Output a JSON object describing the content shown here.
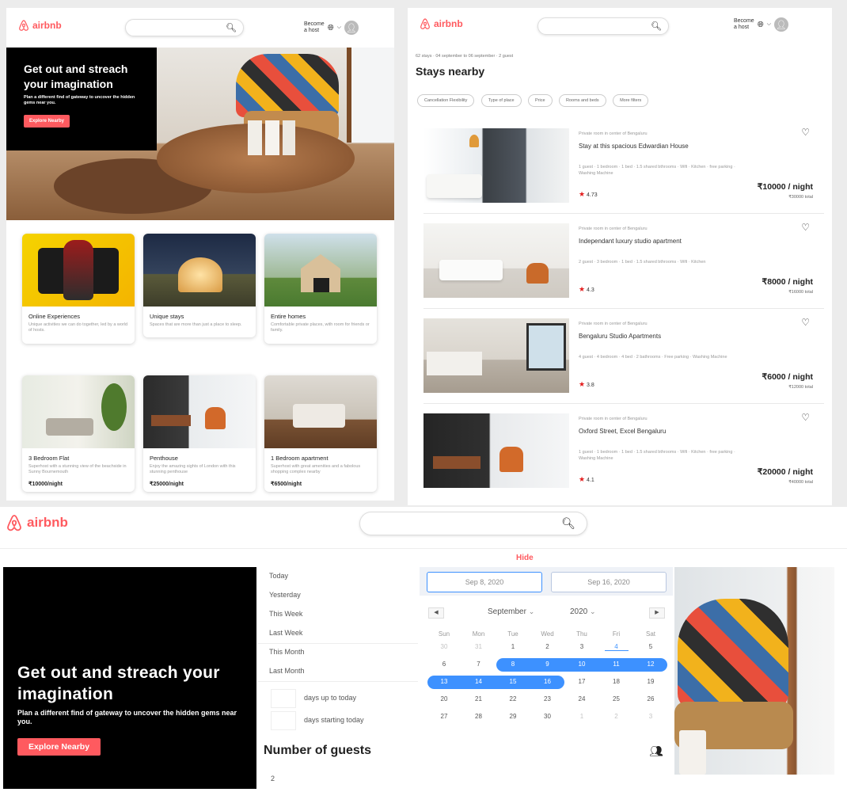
{
  "brand": "airbnb",
  "colors": {
    "accent": "#ff5a5f",
    "calendar_selection": "#3d91ff",
    "star": "#e31c1c"
  },
  "home": {
    "header": {
      "become_host": "Become\na host",
      "globe_icon": "globe",
      "chevron_icon": "chevron-down"
    },
    "hero": {
      "title": "Get out and streach your imagination",
      "subtitle": "Plan a different find of gateway to uncover the hidden gems near you.",
      "button": "Explore Nearby"
    },
    "categories": [
      {
        "title": "Online Experiences",
        "desc": "Unique activities we can do together, led by a world of hosts."
      },
      {
        "title": "Unique stays",
        "desc": "Spaces that are more than just a place to sleep."
      },
      {
        "title": "Entire homes",
        "desc": "Comfortable private places, with room for friends or family."
      }
    ],
    "stays": [
      {
        "title": "3 Bedroom Flat",
        "desc": "Superhost with a stunning view of the beachside in Sunny Bournemouth",
        "price": "₹10000/night"
      },
      {
        "title": "Penthouse",
        "desc": "Enjoy the amazing sights of London with this stunning penthouse",
        "price": "₹25000/night"
      },
      {
        "title": "1 Bedroom apartment",
        "desc": "Superhost with great amenities and a fabolous shopping complex nearby",
        "price": "₹6500/night"
      }
    ]
  },
  "results": {
    "meta": "62 stays · 04 september to 06 september · 2 guest",
    "title": "Stays nearby",
    "filters": [
      "Cancellation Flexibility",
      "Type of place",
      "Price",
      "Rooms and beds",
      "More filters"
    ],
    "listings": [
      {
        "location": "Private room in center of Bengaluru",
        "title": "Stay at this spacious Edwardian House",
        "features": "1 guest · 1 bedroom · 1 bed · 1.5 shared bthrooms · Wifi · Kitchen · free parking · Washing Machine",
        "rating": "4.73",
        "price": "₹10000 / night",
        "total": "₹30000 total"
      },
      {
        "location": "Private room in center of Bengaluru",
        "title": "Independant luxury studio apartment",
        "features": "2 guest · 3 bedroom · 1 bed · 1.5 shared bthrooms · Wifi · Kitchen",
        "rating": "4.3",
        "price": "₹8000 / night",
        "total": "₹16000 total"
      },
      {
        "location": "Private room in center of Bengaluru",
        "title": "Bengaluru Studio Apartments",
        "features": "4 guest · 4 bedroom · 4 bed · 2 bathrooms · Free parking · Washing Machine",
        "rating": "3.8",
        "price": "₹6000 / night",
        "total": "₹12000 total"
      },
      {
        "location": "Private room in center of Bengaluru",
        "title": "Oxford Street, Excel Bengaluru",
        "features": "1 guest · 1 bedroom · 1 bed · 1.5 shared bthrooms · Wifi · Kitchen · free parking · Washing Machine",
        "rating": "4.1",
        "price": "₹20000 / night",
        "total": "₹40000 total"
      }
    ]
  },
  "search_view": {
    "hide": "Hide",
    "hero": {
      "title": "Get out and streach your imagination",
      "subtitle": "Plan a different find of gateway to uncover the hidden gems near you.",
      "button": "Explore Nearby"
    },
    "ranges": [
      "Today",
      "Yesterday",
      "This Week",
      "Last Week",
      "This Month",
      "Last Month"
    ],
    "days_up": "days up to today",
    "days_starting": "days starting today",
    "start_date": "Sep 8, 2020",
    "end_date": "Sep 16, 2020",
    "month": "September",
    "year": "2020",
    "prev_icon": "arrow-left",
    "next_icon": "arrow-right",
    "weekdays": [
      "Sun",
      "Mon",
      "Tue",
      "Wed",
      "Thu",
      "Fri",
      "Sat"
    ],
    "weeks": [
      [
        "30",
        "31",
        "1",
        "2",
        "3",
        "4",
        "5"
      ],
      [
        "6",
        "7",
        "8",
        "9",
        "10",
        "11",
        "12"
      ],
      [
        "13",
        "14",
        "15",
        "16",
        "17",
        "18",
        "19"
      ],
      [
        "20",
        "21",
        "22",
        "23",
        "24",
        "25",
        "26"
      ],
      [
        "27",
        "28",
        "29",
        "30",
        "1",
        "2",
        "3"
      ]
    ],
    "guests_label": "Number of guests",
    "guests_icon": "people",
    "guests_value": "2"
  }
}
